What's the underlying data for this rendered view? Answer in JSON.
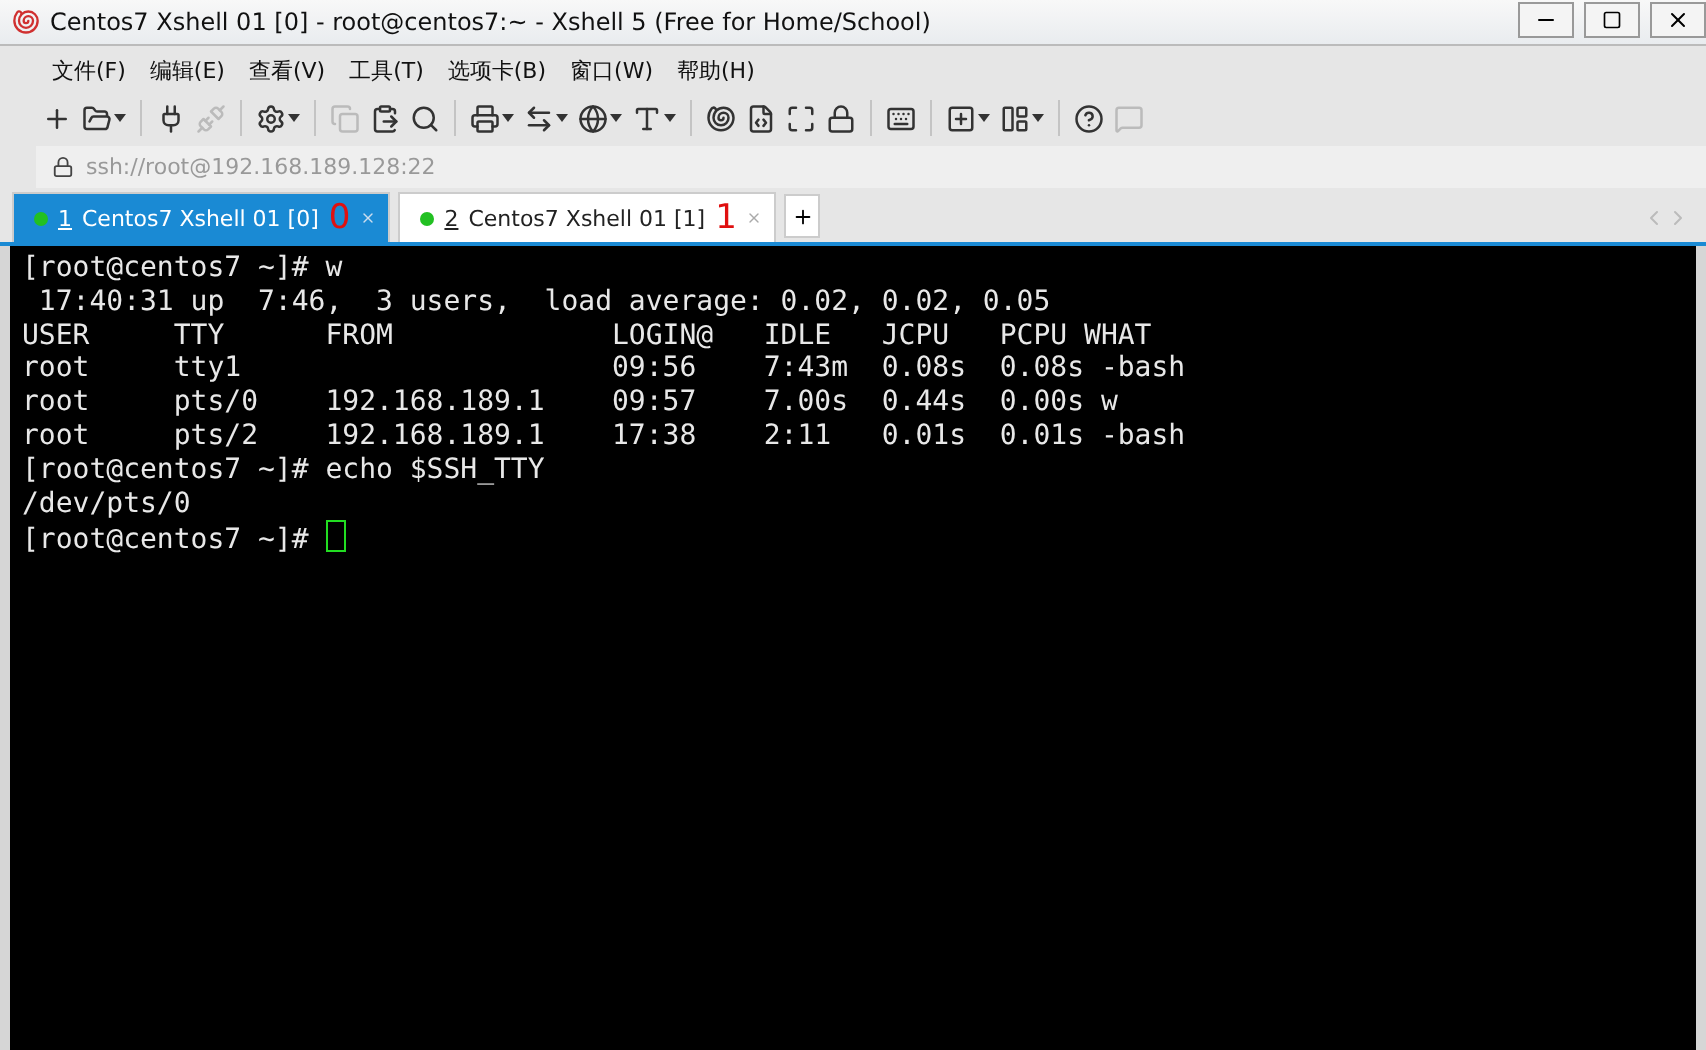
{
  "window": {
    "title": "Centos7 Xshell 01 [0] - root@centos7:~ - Xshell 5 (Free for Home/School)"
  },
  "menu": [
    "文件(F)",
    "编辑(E)",
    "查看(V)",
    "工具(T)",
    "选项卡(B)",
    "窗口(W)",
    "帮助(H)"
  ],
  "toolbar": [
    {
      "kind": "new",
      "caret": false,
      "disabled": false
    },
    {
      "kind": "open",
      "caret": true,
      "disabled": false
    },
    {
      "kind": "sep"
    },
    {
      "kind": "connect",
      "caret": false,
      "disabled": false
    },
    {
      "kind": "disconnect",
      "caret": false,
      "disabled": true
    },
    {
      "kind": "sep"
    },
    {
      "kind": "properties",
      "caret": true,
      "disabled": false
    },
    {
      "kind": "sep"
    },
    {
      "kind": "copy",
      "caret": false,
      "disabled": true
    },
    {
      "kind": "paste",
      "caret": false,
      "disabled": false
    },
    {
      "kind": "find",
      "caret": false,
      "disabled": false
    },
    {
      "kind": "sep"
    },
    {
      "kind": "print",
      "caret": true,
      "disabled": false
    },
    {
      "kind": "transfer",
      "caret": true,
      "disabled": false
    },
    {
      "kind": "globe",
      "caret": true,
      "disabled": false
    },
    {
      "kind": "font",
      "caret": true,
      "disabled": false
    },
    {
      "kind": "sep"
    },
    {
      "kind": "shell",
      "caret": false,
      "disabled": false
    },
    {
      "kind": "script",
      "caret": false,
      "disabled": false
    },
    {
      "kind": "fullscreen",
      "caret": false,
      "disabled": false
    },
    {
      "kind": "lock",
      "caret": false,
      "disabled": false
    },
    {
      "kind": "sep"
    },
    {
      "kind": "keyboard",
      "caret": false,
      "disabled": false
    },
    {
      "kind": "sep"
    },
    {
      "kind": "newtab",
      "caret": true,
      "disabled": false
    },
    {
      "kind": "layout",
      "caret": true,
      "disabled": false
    },
    {
      "kind": "sep"
    },
    {
      "kind": "help",
      "caret": false,
      "disabled": false
    },
    {
      "kind": "chat",
      "caret": false,
      "disabled": true
    }
  ],
  "address": {
    "value": "ssh://root@192.168.189.128:22"
  },
  "tabs": [
    {
      "number": "1",
      "label": "Centos7 Xshell 01 [0]",
      "note": "0",
      "selected": true
    },
    {
      "number": "2",
      "label": "Centos7 Xshell 01 [1]",
      "note": "1",
      "selected": false
    }
  ],
  "terminal": {
    "lines": [
      "[root@centos7 ~]# w",
      " 17:40:31 up  7:46,  3 users,  load average: 0.02, 0.02, 0.05",
      "USER     TTY      FROM             LOGIN@   IDLE   JCPU   PCPU WHAT",
      "root     tty1                      09:56    7:43m  0.08s  0.08s -bash",
      "root     pts/0    192.168.189.1    09:57    7.00s  0.44s  0.00s w",
      "root     pts/2    192.168.189.1    17:38    2:11   0.01s  0.01s -bash",
      "[root@centos7 ~]# echo $SSH_TTY",
      "/dev/pts/0"
    ],
    "prompt": "[root@centos7 ~]# "
  }
}
